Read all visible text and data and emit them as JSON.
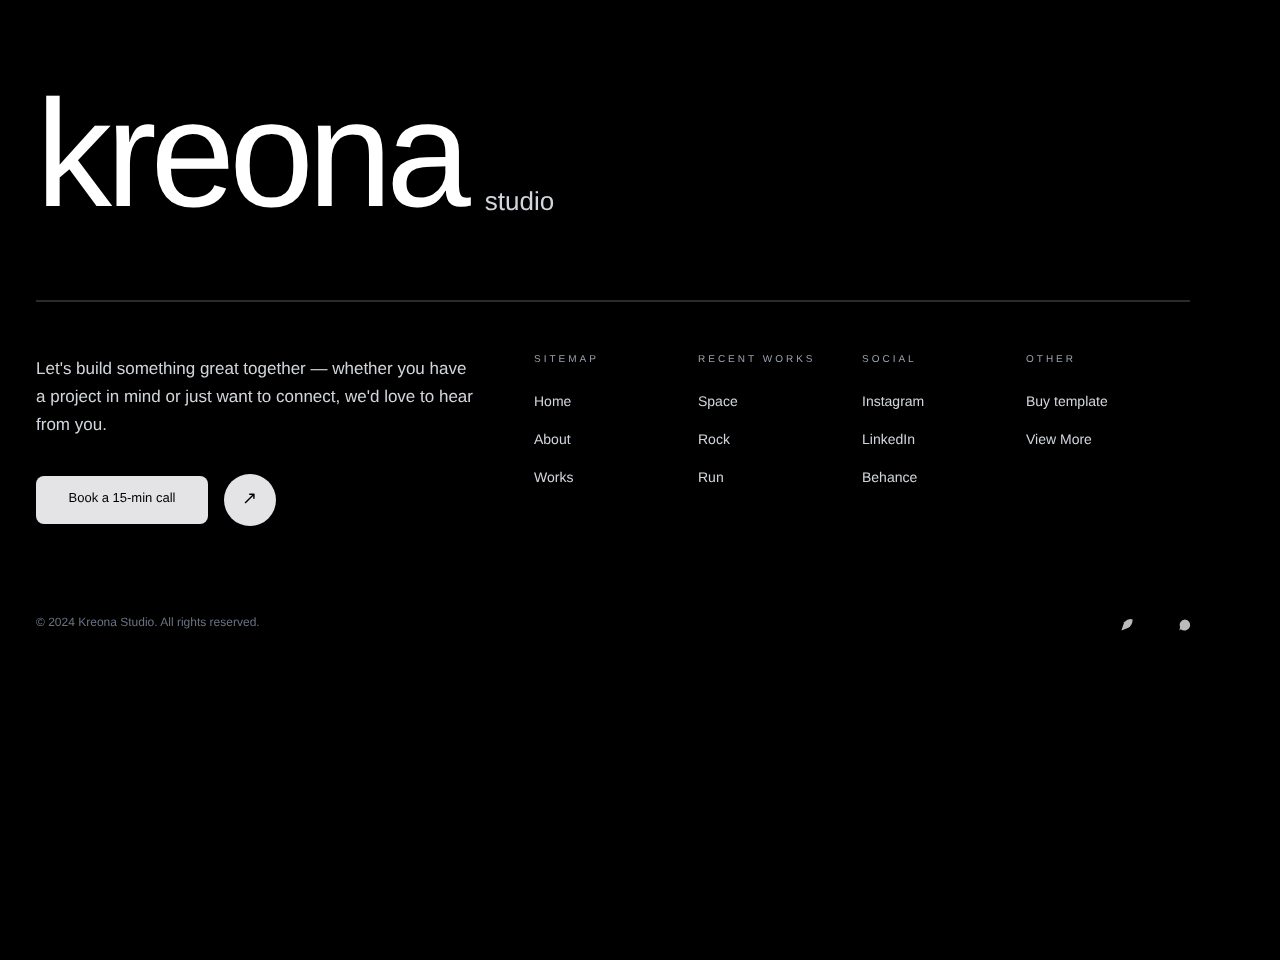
{
  "logo": {
    "name": "kreona",
    "suffix": "studio"
  },
  "intro": "Let's build something great together — whether you have a project in mind or just want to connect, we'd love to hear from you.",
  "cta": {
    "label": "Book a 15-min call",
    "icon_button": "↗"
  },
  "columns": [
    {
      "heading": "SITEMAP",
      "links": [
        "Home",
        "About",
        "Works"
      ]
    },
    {
      "heading": "RECENT WORKS",
      "links": [
        "Space",
        "Rock",
        "Run"
      ]
    },
    {
      "heading": "SOCIAL",
      "links": [
        "Instagram",
        "LinkedIn",
        "Behance"
      ]
    },
    {
      "heading": "OTHER",
      "links": [
        "Buy template",
        "View More"
      ]
    }
  ],
  "footer": {
    "copyright": "© 2024 Kreona Studio. All rights reserved."
  }
}
